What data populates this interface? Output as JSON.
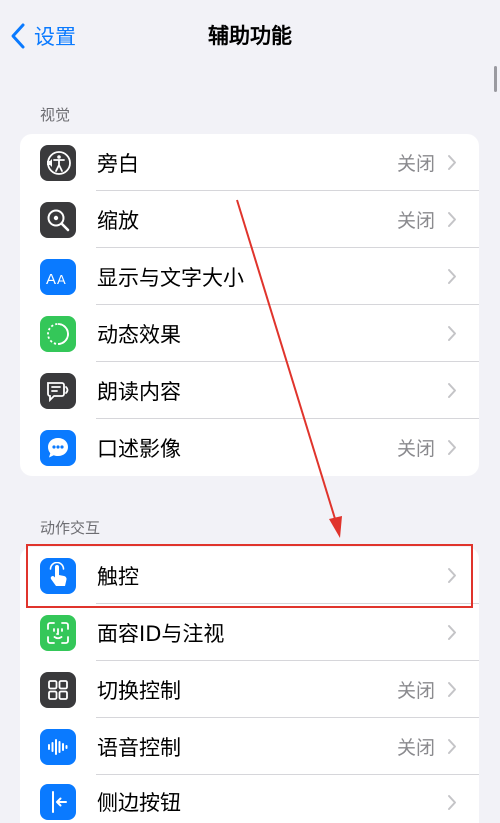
{
  "nav": {
    "back_label": "设置",
    "title": "辅助功能"
  },
  "sections": [
    {
      "header": "视觉",
      "items": [
        {
          "label": "旁白",
          "value": "关闭",
          "icon": "voiceover-icon",
          "color": "#3a3a3c"
        },
        {
          "label": "缩放",
          "value": "关闭",
          "icon": "zoom-icon",
          "color": "#3a3a3c"
        },
        {
          "label": "显示与文字大小",
          "value": "",
          "icon": "display-text-size-icon",
          "color": "#0a7aff"
        },
        {
          "label": "动态效果",
          "value": "",
          "icon": "motion-icon",
          "color": "#34c759"
        },
        {
          "label": "朗读内容",
          "value": "",
          "icon": "spoken-content-icon",
          "color": "#3a3a3c"
        },
        {
          "label": "口述影像",
          "value": "关闭",
          "icon": "audio-descriptions-icon",
          "color": "#0a7aff"
        }
      ]
    },
    {
      "header": "动作交互",
      "items": [
        {
          "label": "触控",
          "value": "",
          "icon": "touch-icon",
          "color": "#0a7aff"
        },
        {
          "label": "面容ID与注视",
          "value": "",
          "icon": "face-id-icon",
          "color": "#34c759"
        },
        {
          "label": "切换控制",
          "value": "关闭",
          "icon": "switch-control-icon",
          "color": "#3a3a3c"
        },
        {
          "label": "语音控制",
          "value": "关闭",
          "icon": "voice-control-icon",
          "color": "#0a7aff"
        },
        {
          "label": "侧边按钮",
          "value": "",
          "icon": "side-button-icon",
          "color": "#0a7aff"
        }
      ]
    }
  ],
  "annotation": {
    "color": "#e0342c"
  }
}
